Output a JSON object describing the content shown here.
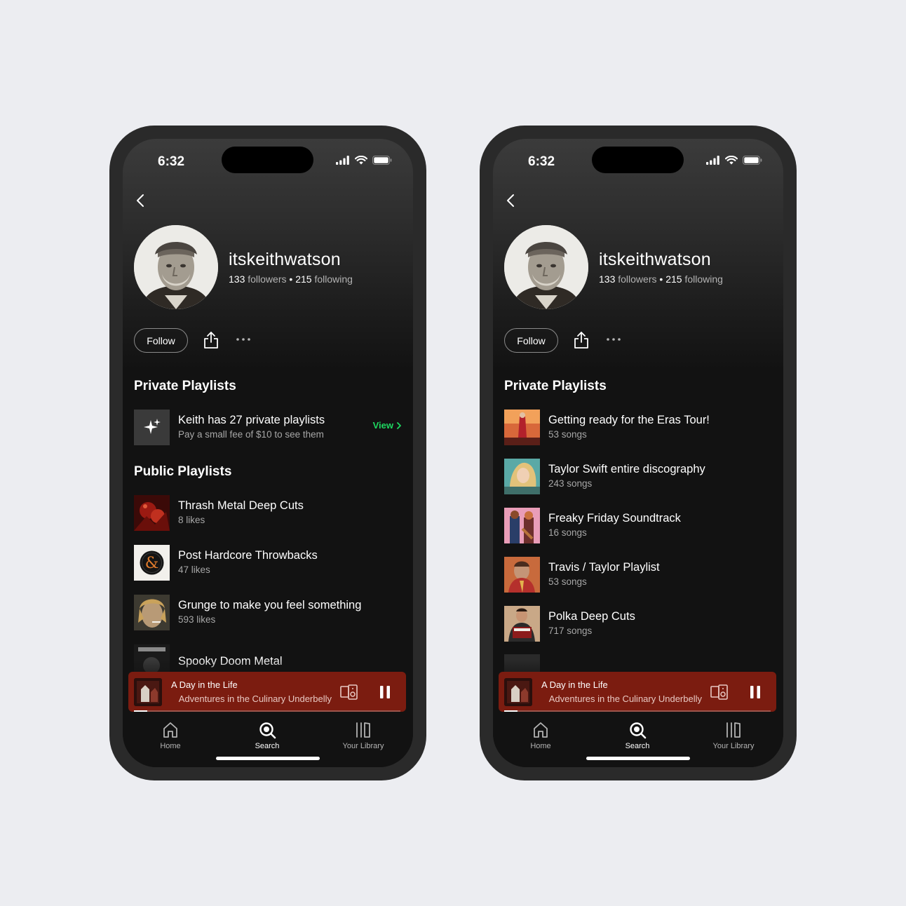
{
  "phones": [
    {
      "status_time": "6:32",
      "profile": {
        "username": "itskeithwatson",
        "followers_count": "133",
        "followers_label": "followers",
        "separator": "•",
        "following_count": "215",
        "following_label": "following"
      },
      "actions": {
        "follow_label": "Follow"
      },
      "sections": {
        "private_title": "Private Playlists",
        "public_title": "Public Playlists"
      },
      "private_summary": {
        "title": "Keith has 27 private playlists",
        "subtitle": "Pay a small fee of $10 to see them",
        "view_label": "View"
      },
      "public_playlists": [
        {
          "title": "Thrash Metal Deep Cuts",
          "subtitle": "8 likes"
        },
        {
          "title": "Post Hardcore Throwbacks",
          "subtitle": "47 likes"
        },
        {
          "title": "Grunge to make you feel something",
          "subtitle": "593 likes"
        },
        {
          "title": "Spooky Doom Metal",
          "subtitle": ""
        }
      ],
      "player": {
        "title": "A Day in the Life",
        "subtitle": "Adventures in the Culinary Underbelly",
        "progress": 0.05
      },
      "nav": {
        "home": "Home",
        "search": "Search",
        "library": "Your Library",
        "active": "search"
      }
    },
    {
      "status_time": "6:32",
      "profile": {
        "username": "itskeithwatson",
        "followers_count": "133",
        "followers_label": "followers",
        "separator": "•",
        "following_count": "215",
        "following_label": "following"
      },
      "actions": {
        "follow_label": "Follow"
      },
      "sections": {
        "private_title": "Private Playlists"
      },
      "private_playlists": [
        {
          "title": "Getting ready for the Eras Tour!",
          "subtitle": "53 songs"
        },
        {
          "title": "Taylor Swift entire discography",
          "subtitle": "243 songs"
        },
        {
          "title": "Freaky Friday Soundtrack",
          "subtitle": "16 songs"
        },
        {
          "title": "Travis / Taylor Playlist",
          "subtitle": "53 songs"
        },
        {
          "title": "Polka Deep Cuts",
          "subtitle": "717 songs"
        }
      ],
      "player": {
        "title": "A Day in the Life",
        "subtitle": "Adventures in the Culinary Underbelly",
        "progress": 0.05
      },
      "nav": {
        "home": "Home",
        "search": "Search",
        "library": "Your Library",
        "active": "search"
      }
    }
  ],
  "colors": {
    "background": "#ecedf1",
    "phone_frame": "#2a2a2a",
    "screen_bg": "#121212",
    "accent_green": "#1ed760",
    "player_bg": "#7b1c10"
  }
}
